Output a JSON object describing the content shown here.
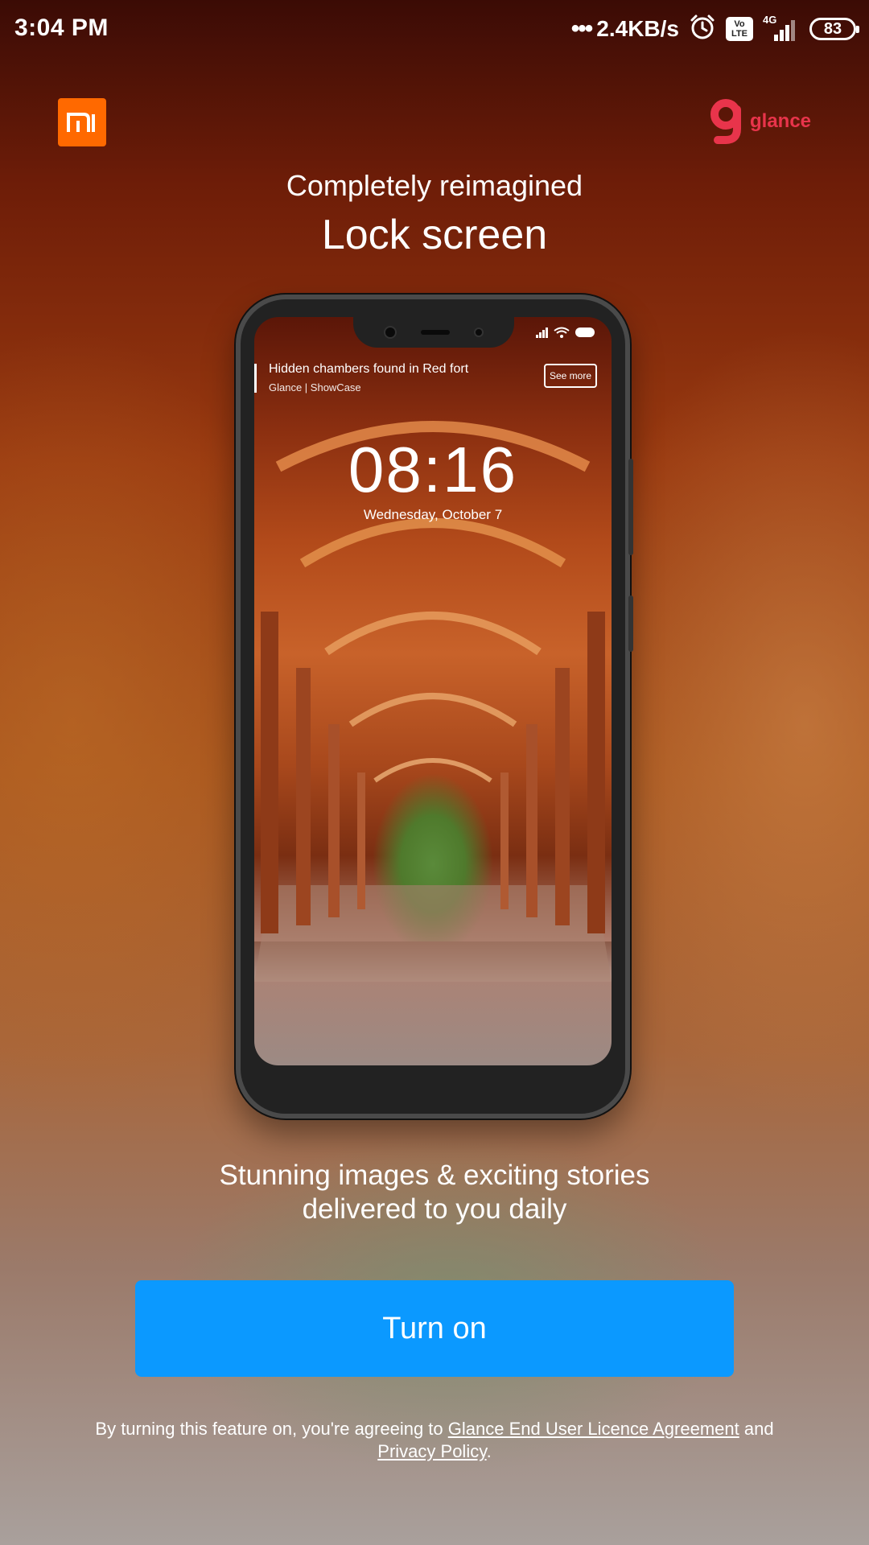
{
  "status_bar": {
    "time": "3:04 PM",
    "dots": "•••",
    "net_speed": "2.4KB/s",
    "volte_top": "Vo",
    "volte_bottom": "LTE",
    "network": "4G",
    "battery": "83"
  },
  "header": {
    "glance_label": "glance"
  },
  "hero": {
    "subtitle": "Completely reimagined",
    "title": "Lock screen"
  },
  "preview": {
    "notification_title": "Hidden chambers found in Red fort",
    "notification_source": "Glance | ShowCase",
    "see_more": "See more",
    "time": "08:16",
    "date": "Wednesday, October 7"
  },
  "tagline": {
    "line1": "Stunning images & exciting stories",
    "line2": "delivered to you daily"
  },
  "cta": {
    "turn_on": "Turn on"
  },
  "legal": {
    "prefix": "By turning this feature on, you're agreeing to ",
    "eula_link": "Glance End User Licence Agreement",
    "and": " and",
    "privacy_link": "Privacy Policy",
    "suffix": "."
  },
  "colors": {
    "accent_blue": "#0b99ff",
    "mi_orange": "#ff6900",
    "glance_red": "#e8344b"
  },
  "icons": {
    "mi": "mi-logo",
    "glance": "glance-g-logo",
    "alarm": "alarm-clock-icon",
    "signal": "signal-bars-icon",
    "wifi": "wifi-icon"
  }
}
